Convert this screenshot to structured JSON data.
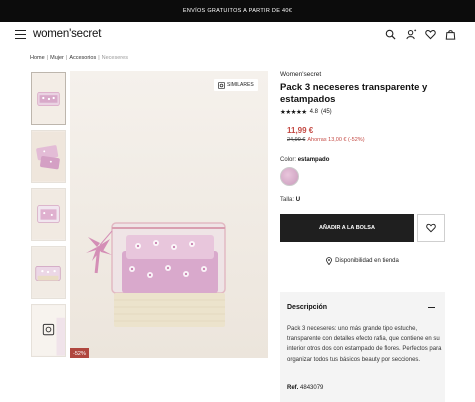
{
  "promo": {
    "text": "ENVÍOS GRATUITOS A PARTIR DE 40€"
  },
  "header": {
    "logo": "women'secret",
    "icons": [
      "menu-icon",
      "search-icon",
      "account-icon",
      "heart-icon",
      "bag-icon"
    ]
  },
  "breadcrumb": {
    "items": [
      "Home",
      "Mujer",
      "Accesorios",
      "Neceseres"
    ],
    "separator": "|"
  },
  "gallery": {
    "similares_label": "SIMILARES",
    "discount_badge": "-52%",
    "thumbnail_count": 5
  },
  "product": {
    "brand": "Women'secret",
    "title": "Pack 3 neceseres transparente y estampados",
    "stars": "★★★★★",
    "rating": "4.8",
    "reviews": "(45)",
    "price": "11,99 €",
    "old_price": "24,99 €",
    "savings": "Ahorras 13,00 € (-52%)",
    "color_label": "Color:",
    "color_value": "estampado",
    "size_label": "Talla:",
    "size_value": "U",
    "add_to_bag": "AÑADIR A LA BOLSA",
    "availability": "Disponibilidad en tienda"
  },
  "description": {
    "heading": "Descripción",
    "text": "Pack 3 neceseres: uno más grande tipo estuche, transparente con detalles efecto rafia, que contiene en su interior otros dos con estampado de flores. Perfectos para organizar todos tus básicos beauty por secciones.",
    "ref_label": "Ref.",
    "ref_value": "4843079"
  },
  "colors": {
    "promo_bg": "#0c0c0c",
    "price_red": "#c44a44",
    "badge_red": "#b0473f",
    "button_dark": "#1f1f1f",
    "desc_bg": "#f4f4f4"
  }
}
